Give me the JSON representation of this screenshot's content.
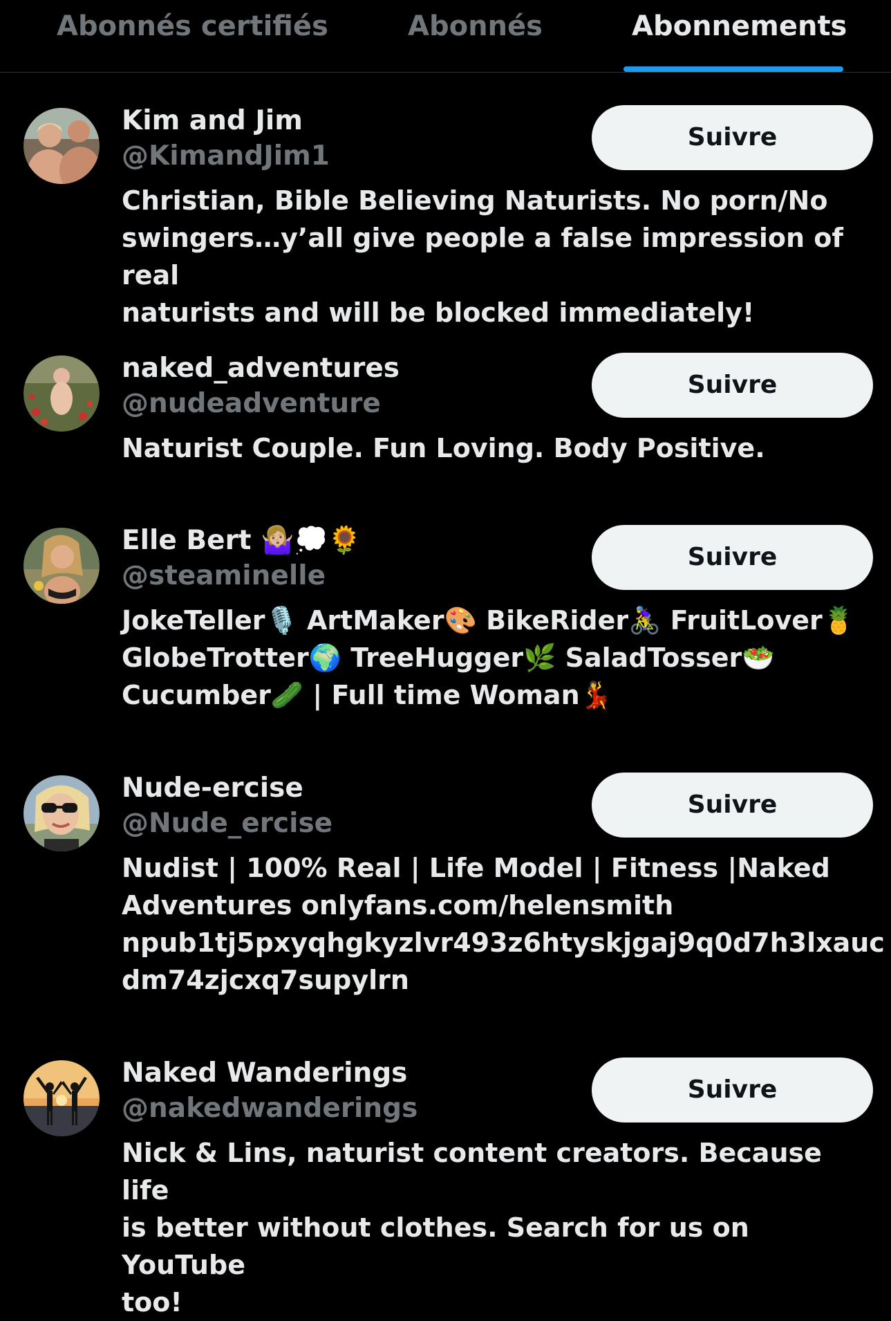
{
  "tabs": [
    {
      "label": "Abonnés certifiés",
      "active": false
    },
    {
      "label": "Abonnés",
      "active": false
    },
    {
      "label": "Abonnements",
      "active": true
    }
  ],
  "colors": {
    "background": "#000000",
    "text_primary": "#e7e9ea",
    "text_secondary": "#71767b",
    "accent": "#1d9bf0",
    "button_bg": "#eff3f4",
    "button_text": "#0f1419"
  },
  "users": [
    {
      "name": "Kim and Jim",
      "handle": "@KimandJim1",
      "bio": "Christian, Bible Believing Naturists. No porn/No\nswingers…y’all give people a false impression of real\nnaturists and will be blocked immediately!",
      "follow_label": "Suivre",
      "avatar_icon": "couple-photo-avatar"
    },
    {
      "name": "naked_adventures",
      "handle": "@nudeadventure",
      "bio": "Naturist Couple. Fun Loving. Body Positive.",
      "follow_label": "Suivre",
      "avatar_icon": "field-photo-avatar"
    },
    {
      "name": "Elle Bert 🤷🏼‍♀️💭🌻",
      "handle": "@steaminelle",
      "bio": "JokeTeller🎙️ ArtMaker🎨 BikeRider🚴‍♀️ FruitLover🍍\nGlobeTrotter🌍 TreeHugger🌿 SaladTosser🥗\nCucumber🥒 | Full time Woman💃",
      "follow_label": "Suivre",
      "avatar_icon": "woman-photo-avatar"
    },
    {
      "name": "Nude-ercise",
      "handle": "@Nude_ercise",
      "bio": "Nudist | 100% Real | Life Model | Fitness |Naked\nAdventures onlyfans.com/helensmith\nnpub1tj5pxyqhgkyzlvr493z6htyskjgaj9q0d7h3lxauc\ndm74zjcxq7supylrn",
      "follow_label": "Suivre",
      "avatar_icon": "sunglasses-photo-avatar"
    },
    {
      "name": "Naked Wanderings",
      "handle": "@nakedwanderings",
      "bio": "Nick & Lins, naturist content creators. Because life\nis better without clothes. Search for us on YouTube\ntoo!",
      "follow_label": "Suivre",
      "avatar_icon": "sunset-silhouette-avatar"
    }
  ]
}
